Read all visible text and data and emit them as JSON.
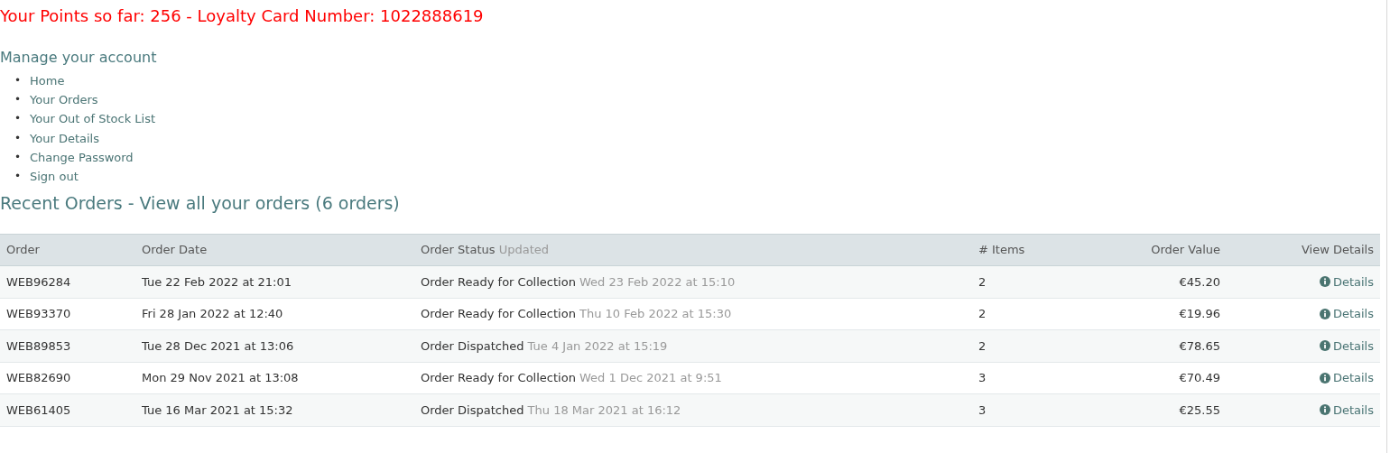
{
  "points_banner": "Your Points so far: 256 - Loyalty Card Number: 1022888619",
  "account_menu": {
    "title": "Manage your account",
    "items": [
      {
        "bullet": "•",
        "label": "Home"
      },
      {
        "bullet": "•",
        "label": "Your Orders"
      },
      {
        "bullet": "•",
        "label": "Your Out of Stock List"
      },
      {
        "bullet": "•",
        "label": "Your Details"
      },
      {
        "bullet": "•",
        "label": "Change Password"
      },
      {
        "bullet": "•",
        "label": "Sign out"
      }
    ]
  },
  "recent_orders": {
    "title": "Recent Orders - View all your orders (6 orders)",
    "columns": [
      {
        "label": "Order"
      },
      {
        "label": "Order Date"
      },
      {
        "label": "Order Status",
        "note": "Updated"
      },
      {
        "label": "# Items"
      },
      {
        "label": "Order Value"
      },
      {
        "label": "View Details"
      }
    ],
    "rows": [
      {
        "order": "WEB96284",
        "date": "Tue 22 Feb 2022 at 21:01",
        "status": "Order Ready for Collection",
        "updated": "Wed 23 Feb 2022 at 15:10",
        "items": "2",
        "value": "€45.20",
        "details": "Details"
      },
      {
        "order": "WEB93370",
        "date": "Fri 28 Jan 2022 at 12:40",
        "status": "Order Ready for Collection",
        "updated": "Thu 10 Feb 2022 at 15:30",
        "items": "2",
        "value": "€19.96",
        "details": "Details"
      },
      {
        "order": "WEB89853",
        "date": "Tue 28 Dec 2021 at 13:06",
        "status": "Order Dispatched",
        "updated": "Tue 4 Jan 2022 at 15:19",
        "items": "2",
        "value": "€78.65",
        "details": "Details"
      },
      {
        "order": "WEB82690",
        "date": "Mon 29 Nov 2021 at 13:08",
        "status": "Order Ready for Collection",
        "updated": "Wed 1 Dec 2021 at 9:51",
        "items": "3",
        "value": "€70.49",
        "details": "Details"
      },
      {
        "order": "WEB61405",
        "date": "Tue 16 Mar 2021 at 15:32",
        "status": "Order Dispatched",
        "updated": "Thu 18 Mar 2021 at 16:12",
        "items": "3",
        "value": "€25.55",
        "details": "Details"
      }
    ]
  }
}
